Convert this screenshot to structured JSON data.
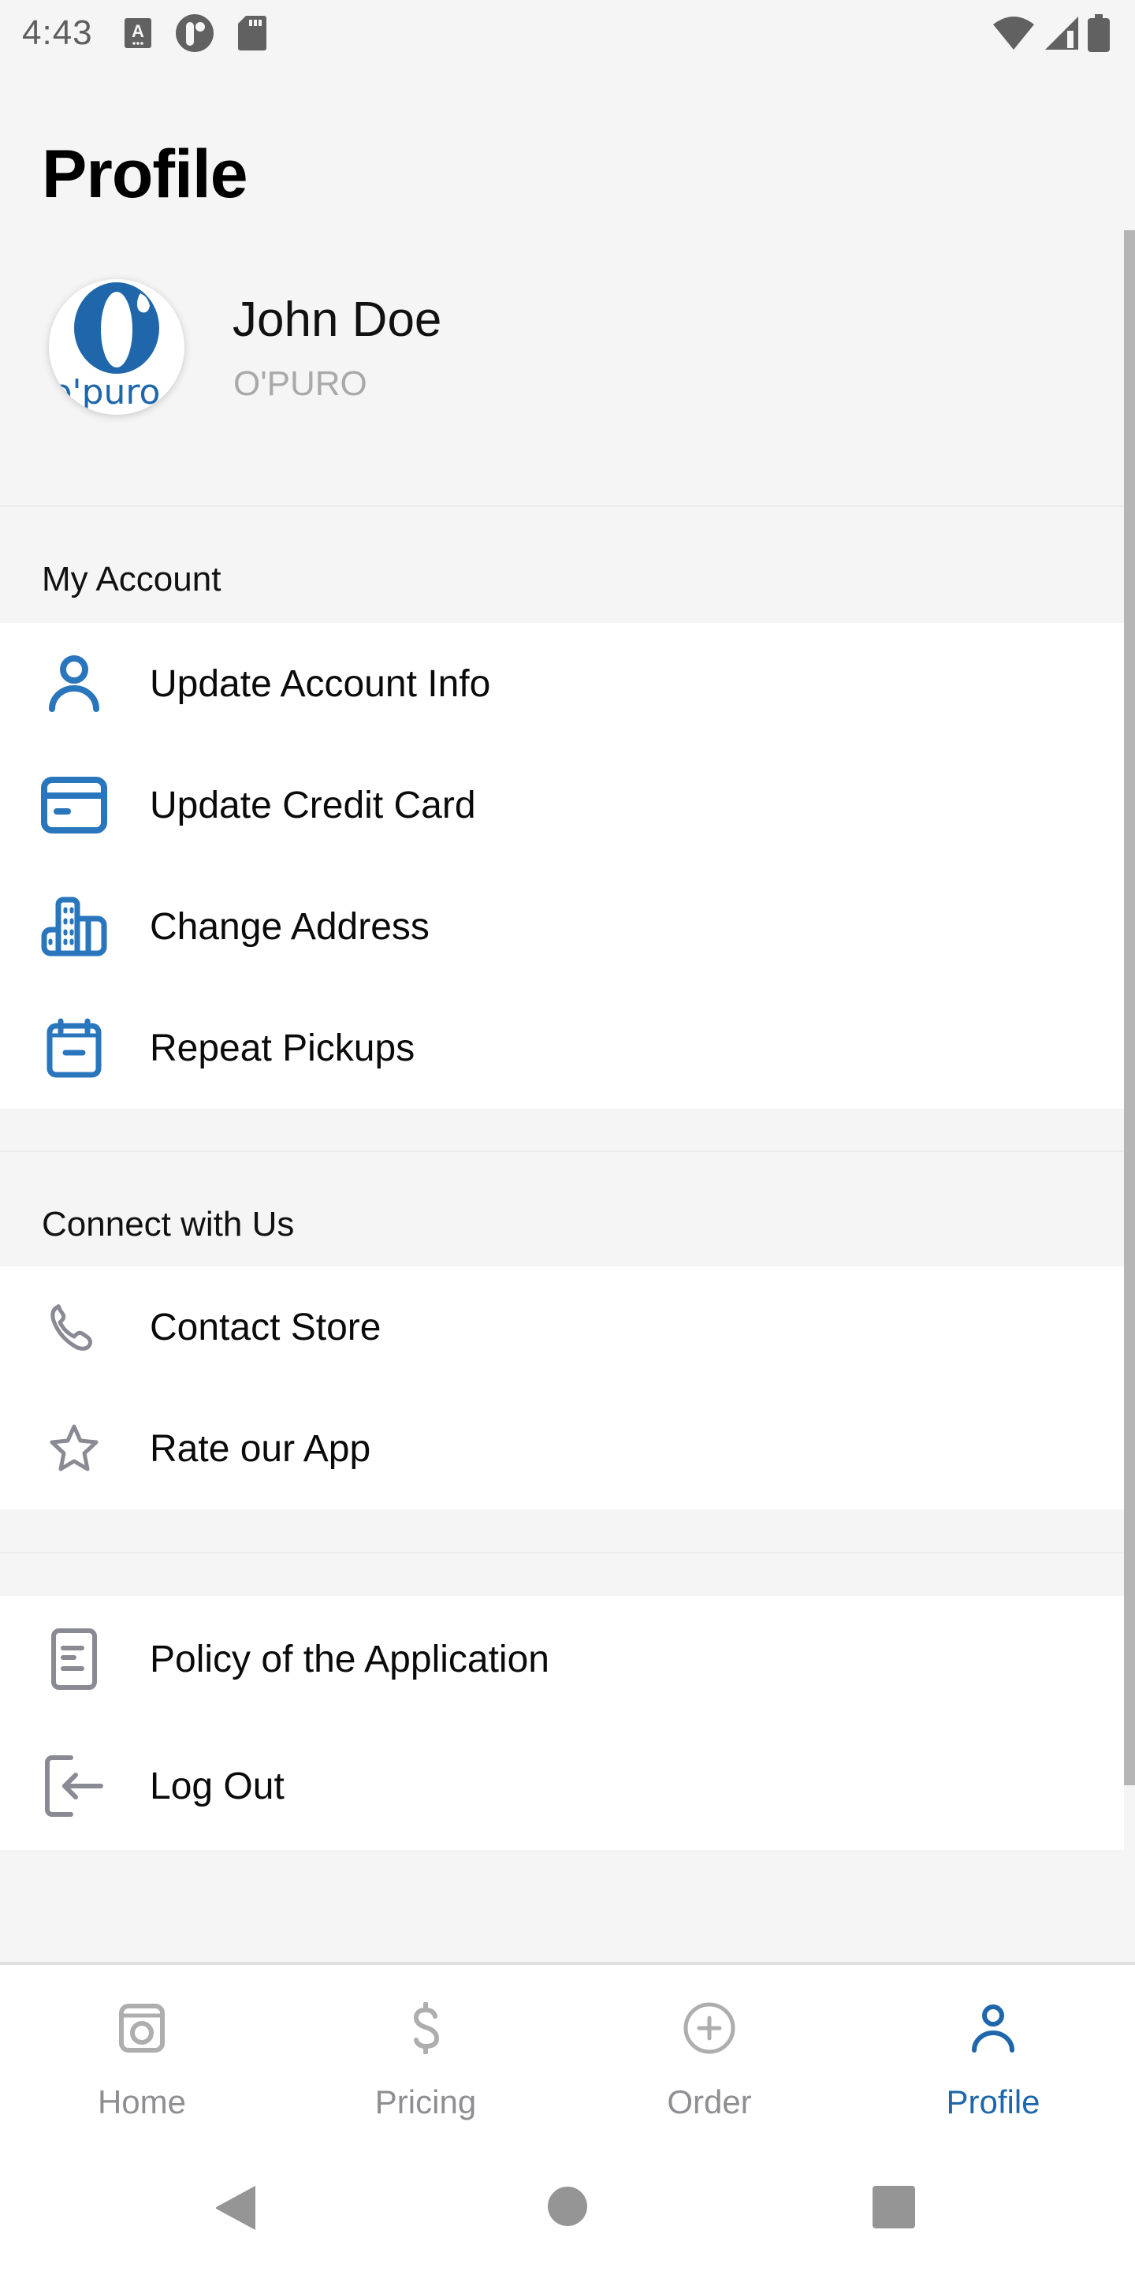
{
  "status_bar": {
    "time": "4:43",
    "left_icons": [
      "keyboard-a-icon",
      "app-notification-icon",
      "sd-card-icon"
    ],
    "right_icons": [
      "wifi-icon",
      "cell-signal-icon",
      "battery-icon"
    ]
  },
  "page": {
    "title": "Profile"
  },
  "profile": {
    "name": "John Doe",
    "company": "O'PURO",
    "avatar_logo_text": "o'puro",
    "avatar_logo_letter": "O"
  },
  "sections": [
    {
      "header": "My Account",
      "items": [
        {
          "label": "Update Account Info",
          "icon": "user-icon"
        },
        {
          "label": "Update Credit Card",
          "icon": "credit-card-icon"
        },
        {
          "label": "Change Address",
          "icon": "building-icon"
        },
        {
          "label": "Repeat Pickups",
          "icon": "calendar-icon"
        }
      ]
    },
    {
      "header": "Connect with Us",
      "items": [
        {
          "label": "Contact Store",
          "icon": "phone-icon"
        },
        {
          "label": "Rate our App",
          "icon": "star-icon"
        }
      ]
    },
    {
      "header": "",
      "items": [
        {
          "label": "Policy of the Application",
          "icon": "document-icon"
        },
        {
          "label": "Log Out",
          "icon": "logout-icon"
        }
      ]
    }
  ],
  "bottom_nav": {
    "tabs": [
      {
        "label": "Home",
        "icon": "washing-machine-icon",
        "active": false
      },
      {
        "label": "Pricing",
        "icon": "dollar-icon",
        "active": false
      },
      {
        "label": "Order",
        "icon": "plus-circle-icon",
        "active": false
      },
      {
        "label": "Profile",
        "icon": "user-icon",
        "active": true
      }
    ]
  },
  "colors": {
    "accent": "#1f67aa",
    "icon_blue": "#2a76bd",
    "icon_gray": "#8a8a94",
    "inactive_nav": "#8e8e93",
    "background": "#f5f5f5"
  }
}
